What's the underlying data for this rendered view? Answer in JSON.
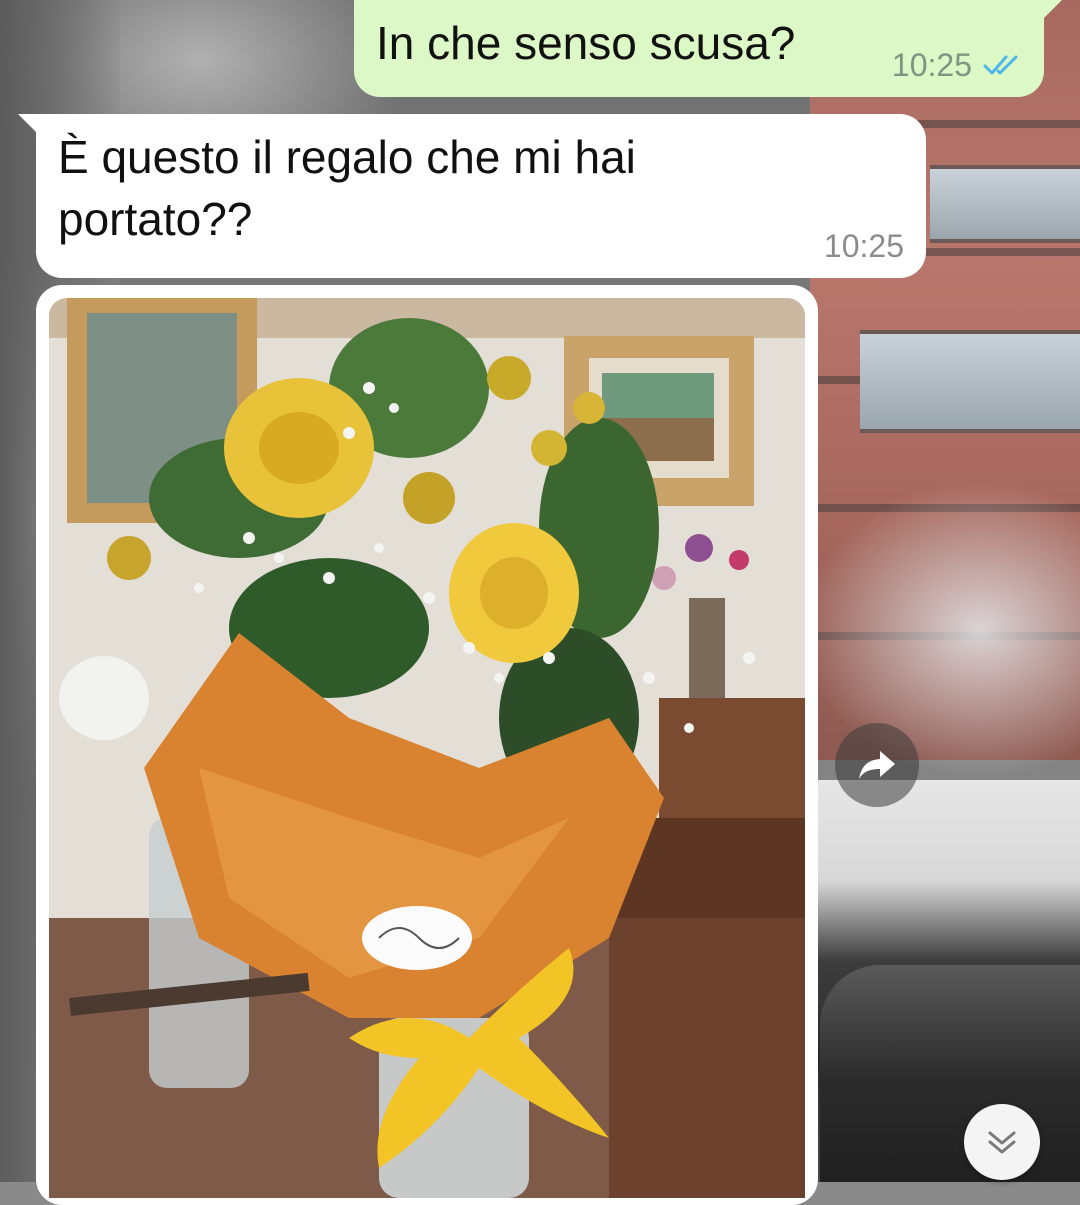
{
  "messages": [
    {
      "direction": "outgoing",
      "text": "In che senso scusa?",
      "time": "10:25",
      "status_icon": "double-check-read-icon"
    },
    {
      "direction": "incoming",
      "text": "È questo il regalo che mi hai\nportato??",
      "time": "10:25"
    },
    {
      "direction": "incoming",
      "type": "image",
      "image_description_icon": "photo-flower-bouquet"
    }
  ],
  "buttons": {
    "forward_icon": "forward-arrow-icon",
    "scroll_down_icon": "chevron-down-double-icon"
  },
  "colors": {
    "outgoing_bubble": "#dcf8c6",
    "incoming_bubble": "#ffffff",
    "read_ticks": "#4fb6ec",
    "timestamp": "#8c8c8c"
  }
}
